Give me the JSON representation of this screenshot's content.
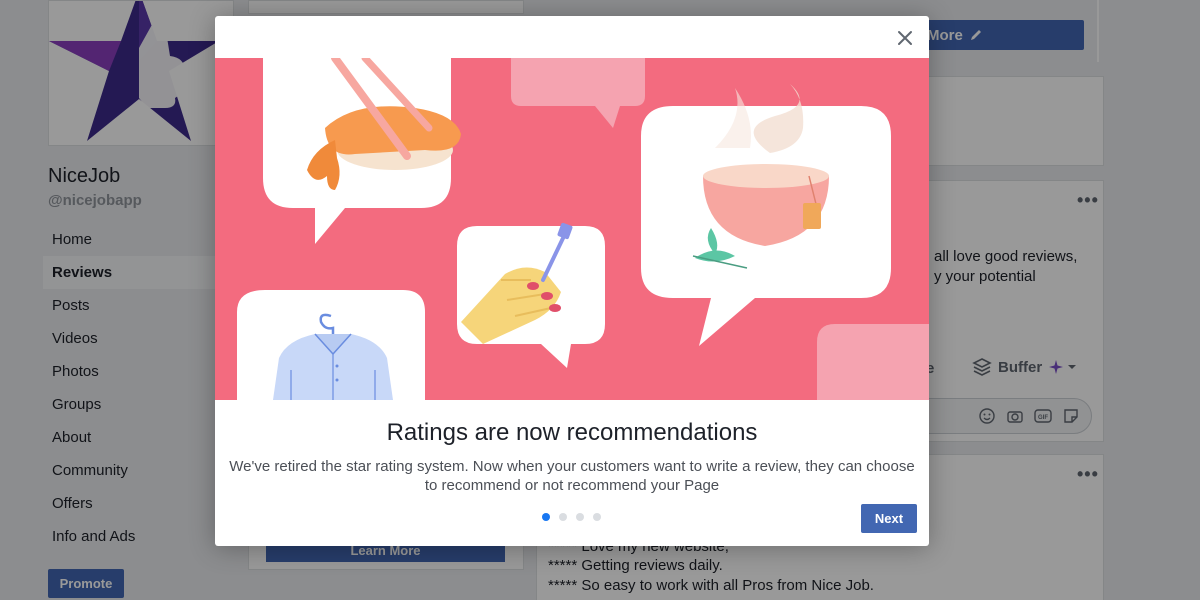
{
  "page": {
    "name": "NiceJob",
    "handle": "@nicejobapp",
    "nav": [
      {
        "label": "Home"
      },
      {
        "label": "Reviews"
      },
      {
        "label": "Posts"
      },
      {
        "label": "Videos"
      },
      {
        "label": "Photos"
      },
      {
        "label": "Groups"
      },
      {
        "label": "About"
      },
      {
        "label": "Community"
      },
      {
        "label": "Offers"
      },
      {
        "label": "Info and Ads"
      }
    ],
    "promote_label": "Promote",
    "edit_label": "More",
    "post_text_1": "all love good reviews,",
    "post_text_2": "y your potential",
    "truncated_e": "e",
    "buffer_label": "Buffer",
    "learn_more_label": "Learn More",
    "reviews": [
      "***** Love my new website,",
      "***** Getting reviews daily.",
      "***** So easy to work with all Pros from Nice Job."
    ]
  },
  "modal": {
    "title": "Ratings are now recommendations",
    "body": "We've retired the star rating system. Now when your customers want to write a review, they can choose to recommend or not recommend your Page",
    "next_label": "Next",
    "hero_bg": "#f36b7f"
  }
}
